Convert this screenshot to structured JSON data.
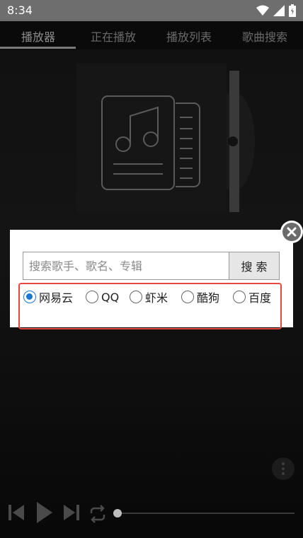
{
  "status_bar": {
    "time": "8:34"
  },
  "tabs": [
    {
      "label": "播放器",
      "active": true
    },
    {
      "label": "正在播放",
      "active": false
    },
    {
      "label": "播放列表",
      "active": false
    },
    {
      "label": "歌曲搜索",
      "active": false
    }
  ],
  "search_dialog": {
    "placeholder": "搜索歌手、歌名、专辑",
    "value": "",
    "search_button": "搜 索",
    "sources": [
      {
        "label": "网易云",
        "checked": true
      },
      {
        "label": "QQ",
        "checked": false
      },
      {
        "label": "虾米",
        "checked": false
      },
      {
        "label": "酷狗",
        "checked": false
      },
      {
        "label": "百度",
        "checked": false
      }
    ],
    "highlight_color": "#e8473c",
    "accent_color": "#1976d2"
  },
  "player": {
    "progress": 0,
    "icons": [
      "previous-icon",
      "play-icon",
      "next-icon",
      "repeat-icon",
      "more-icon",
      "album-art-icon"
    ]
  }
}
